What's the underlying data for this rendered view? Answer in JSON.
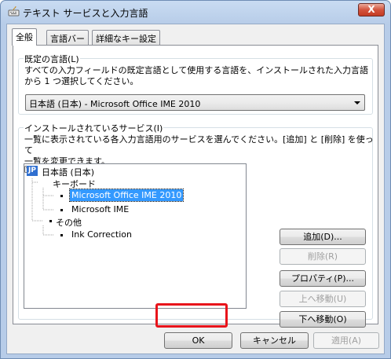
{
  "window": {
    "title": "テキスト サービスと入力言語",
    "close_label": "X"
  },
  "tabs": [
    {
      "label": "全般",
      "active": true
    },
    {
      "label": "言語バー",
      "active": false
    },
    {
      "label": "詳細なキー設定",
      "active": false
    }
  ],
  "default_language": {
    "group_title": "既定の言語(L)",
    "description_line1": "すべての入力フィールドの既定言語として使用する言語を、インストールされた入力言語",
    "description_line2": "から 1 つ選択してください。",
    "selected": "日本語 (日本) - Microsoft Office IME 2010"
  },
  "installed_services": {
    "group_title": "インストールされているサービス(I)",
    "description_line1": "一覧に表示されている各入力言語用のサービスを選んでください。[追加] と [削除] を使って",
    "description_line2": "一覧を変更できます。",
    "tree": {
      "language_badge": "JP",
      "language": "日本語 (日本)",
      "keyboard_label": "キーボード",
      "keyboard_items": [
        "Microsoft Office IME 2010",
        "Microsoft IME"
      ],
      "other_label": "その他",
      "other_items": [
        "Ink Correction"
      ]
    },
    "buttons": {
      "add": "追加(D)...",
      "remove": "削除(R)",
      "properties": "プロパティ(P)...",
      "move_up": "上へ移動(U)",
      "move_down": "下へ移動(O)"
    }
  },
  "footer": {
    "ok": "OK",
    "cancel": "キャンセル",
    "apply": "適用(A)"
  },
  "colors": {
    "highlight_border": "#e8141b",
    "selection": "#3399ff"
  }
}
